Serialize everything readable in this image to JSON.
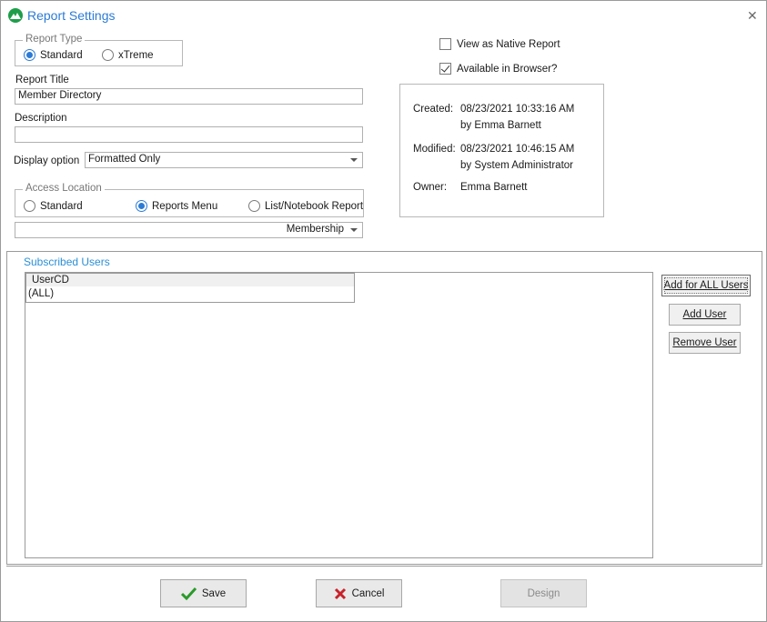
{
  "window": {
    "title": "Report Settings",
    "icon": "app-logo-icon",
    "close_icon": "close-icon"
  },
  "report_type": {
    "legend": "Report Type",
    "options": [
      {
        "label": "Standard",
        "selected": true
      },
      {
        "label": "xTreme",
        "selected": false
      }
    ]
  },
  "report_title": {
    "label": "Report Title",
    "value": "Member Directory"
  },
  "description": {
    "label": "Description",
    "value": ""
  },
  "display_option": {
    "label": "Display option",
    "value": "Formatted Only"
  },
  "access_location": {
    "legend": "Access Location",
    "options": [
      {
        "label": "Standard",
        "selected": false
      },
      {
        "label": "Reports Menu",
        "selected": true
      },
      {
        "label": "List/Notebook Report",
        "selected": false
      }
    ],
    "menu_value": "Membership"
  },
  "flags": {
    "native_label": "View as Native Report",
    "native_checked": false,
    "browser_label": "Available in Browser?",
    "browser_checked": true
  },
  "info": {
    "created_label": "Created:",
    "created_value": "08/23/2021 10:33:16 AM",
    "created_by": "by  Emma Barnett",
    "modified_label": "Modified:",
    "modified_value": "08/23/2021 10:46:15 AM",
    "modified_by": "by  System Administrator",
    "owner_label": "Owner:",
    "owner_value": "Emma Barnett"
  },
  "subscribed": {
    "title": "Subscribed Users",
    "column": "UserCD",
    "rows": [
      "(ALL)"
    ],
    "add_all_label": "Add for ALL Users",
    "add_user_label": "Add User",
    "remove_user_label": "Remove User"
  },
  "footer": {
    "save_label": "Save",
    "cancel_label": "Cancel",
    "design_label": "Design",
    "save_icon": "checkmark-icon",
    "cancel_icon": "x-icon"
  },
  "colors": {
    "accent": "#2b7bd6",
    "logo": "#1e9e4a",
    "save_green": "#2a9a2a",
    "cancel_red": "#c8222a"
  }
}
